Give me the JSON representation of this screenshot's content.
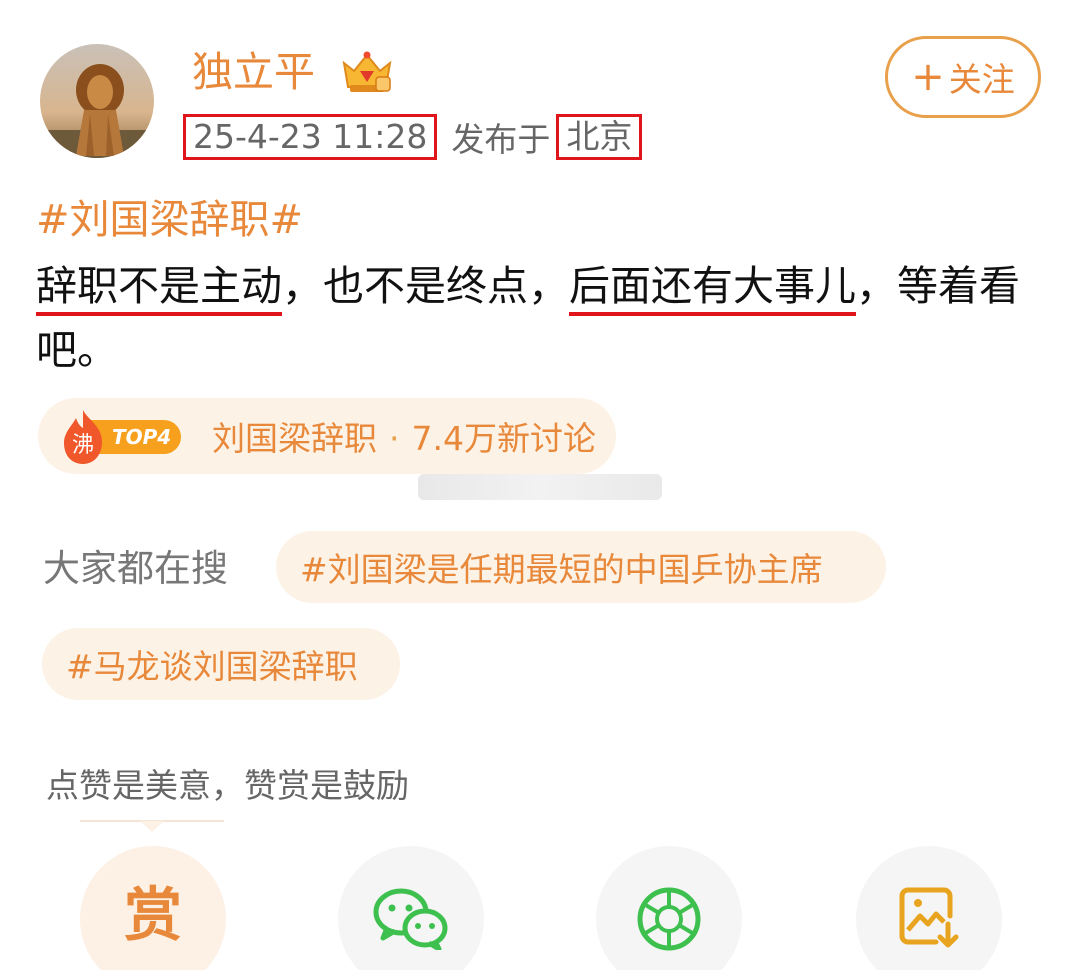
{
  "post": {
    "username": "独立平",
    "timestamp": "25-4-23 11:28",
    "published_at_label": "发布于",
    "location": "北京",
    "follow_label": "关注",
    "hashtag": "#刘国梁辞职#",
    "text": {
      "seg1": "辞职不是主动",
      "seg2": "，也不是终点，",
      "seg3": "后面还有大事儿",
      "seg4": "，等着看吧。"
    }
  },
  "trending": {
    "fire_label": "沸",
    "rank_label": "TOP4",
    "topic": "刘国梁辞职",
    "separator": "·",
    "stat": "7.4万新讨论"
  },
  "related_search": {
    "label": "大家都在搜",
    "chips": [
      "#刘国梁是任期最短的中国乒协主席",
      "#马龙谈刘国梁辞职"
    ]
  },
  "reward": {
    "hint": "点赞是美意，赞赏是鼓励",
    "reward_glyph": "赏"
  },
  "share_actions": [
    "reward-button",
    "wechat-icon",
    "moments-icon",
    "save-image-icon"
  ],
  "colors": {
    "accent": "#e8883a",
    "highlight_red": "#e0141b",
    "chip_bg": "#fdf2e6",
    "wechat_green": "#3ec04f"
  }
}
